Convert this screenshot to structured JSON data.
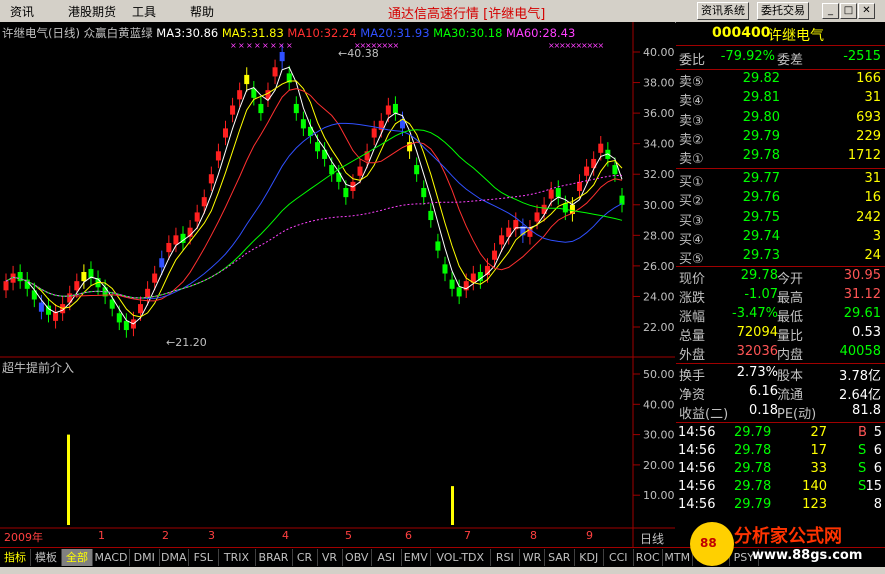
{
  "menubar": {
    "items": [
      "资讯",
      "港股期货",
      "工具",
      "帮助"
    ],
    "app_title": "通达信高速行情 [许继电气]",
    "btn_news": "资讯系统",
    "btn_trade": "委托交易"
  },
  "chart": {
    "header_name": "许继电气(日线) 众赢白黄蓝绿",
    "ma": [
      {
        "label": "MA3:30.86",
        "color": "#ffffff"
      },
      {
        "label": "MA5:31.83",
        "color": "#ffff00"
      },
      {
        "label": "MA10:32.24",
        "color": "#ff3030"
      },
      {
        "label": "MA20:31.93",
        "color": "#3050ff"
      },
      {
        "label": "MA30:30.18",
        "color": "#00ff00"
      },
      {
        "label": "MA60:28.43",
        "color": "#ff40ff"
      }
    ],
    "high_marker": "40.38",
    "low_marker": "21.20",
    "price_axis": [
      "40.00",
      "38.00",
      "36.00",
      "34.00",
      "32.00",
      "30.00",
      "28.00",
      "26.00",
      "24.00",
      "22.00"
    ],
    "indicator_title": "超牛提前介入",
    "indicator_axis": [
      "50.00",
      "40.00",
      "30.00",
      "20.00",
      "10.00"
    ],
    "time_axis": [
      "2009年",
      "1",
      "2",
      "3",
      "4",
      "5",
      "6",
      "7",
      "8",
      "9"
    ],
    "period_label": "日线"
  },
  "quote": {
    "code": "000400",
    "name": "许继电气",
    "weibi_label": "委比",
    "weibi": "-79.92%",
    "weicha_label": "委差",
    "weicha": "-2515",
    "sell": [
      {
        "label": "卖⑤",
        "price": "29.82",
        "vol": "166"
      },
      {
        "label": "卖④",
        "price": "29.81",
        "vol": "31"
      },
      {
        "label": "卖③",
        "price": "29.80",
        "vol": "693"
      },
      {
        "label": "卖②",
        "price": "29.79",
        "vol": "229"
      },
      {
        "label": "卖①",
        "price": "29.78",
        "vol": "1712"
      }
    ],
    "buy": [
      {
        "label": "买①",
        "price": "29.77",
        "vol": "31"
      },
      {
        "label": "买②",
        "price": "29.76",
        "vol": "16"
      },
      {
        "label": "买③",
        "price": "29.75",
        "vol": "242"
      },
      {
        "label": "买④",
        "price": "29.74",
        "vol": "3"
      },
      {
        "label": "买⑤",
        "price": "29.73",
        "vol": "24"
      }
    ],
    "stats": [
      {
        "l1": "现价",
        "v1": "29.78",
        "c1": "green",
        "l2": "今开",
        "v2": "30.95",
        "c2": "red"
      },
      {
        "l1": "涨跌",
        "v1": "-1.07",
        "c1": "green",
        "l2": "最高",
        "v2": "31.12",
        "c2": "red"
      },
      {
        "l1": "涨幅",
        "v1": "-3.47%",
        "c1": "green",
        "l2": "最低",
        "v2": "29.61",
        "c2": "green"
      },
      {
        "l1": "总量",
        "v1": "72094",
        "c1": "yellow",
        "l2": "量比",
        "v2": "0.53",
        "c2": "white"
      },
      {
        "l1": "外盘",
        "v1": "32036",
        "c1": "red",
        "l2": "内盘",
        "v2": "40058",
        "c2": "green"
      }
    ],
    "fund": [
      {
        "l1": "换手",
        "v1": "2.73%",
        "l2": "股本",
        "v2": "3.78亿"
      },
      {
        "l1": "净资",
        "v1": "6.16",
        "l2": "流通",
        "v2": "2.64亿"
      },
      {
        "l1": "收益(二)",
        "v1": "0.18",
        "l2": "PE(动)",
        "v2": "81.8"
      }
    ],
    "ticks": [
      {
        "time": "14:56",
        "price": "29.79",
        "vol": "27",
        "dir": "B",
        "dir_color": "red",
        "n": "5"
      },
      {
        "time": "14:56",
        "price": "29.78",
        "vol": "17",
        "dir": "S",
        "dir_color": "green",
        "n": "6"
      },
      {
        "time": "14:56",
        "price": "29.78",
        "vol": "33",
        "dir": "S",
        "dir_color": "green",
        "n": "6"
      },
      {
        "time": "14:56",
        "price": "29.78",
        "vol": "140",
        "dir": "S",
        "dir_color": "green",
        "n": "15"
      },
      {
        "time": "14:56",
        "price": "29.79",
        "vol": "123",
        "dir": "",
        "dir_color": "red",
        "n": "8"
      }
    ]
  },
  "tabs": [
    "指标",
    "模板",
    "全部",
    "MACD",
    "DMI",
    "DMA",
    "FSL",
    "TRIX",
    "BRAR",
    "CR",
    "VR",
    "OBV",
    "ASI",
    "EMV",
    "VOL-TDX",
    "RSI",
    "WR",
    "SAR",
    "KDJ",
    "CCI",
    "ROC",
    "MTM",
    "BOLL",
    "PSY"
  ],
  "watermark": {
    "title": "分析家公式网",
    "url": "www.88gs.com"
  }
}
